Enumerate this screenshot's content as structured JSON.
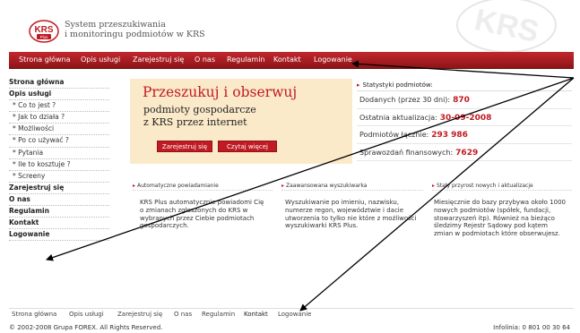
{
  "header": {
    "logo_text": "KRS",
    "logo_sub": "Plus",
    "tagline_line1": "System przeszukiwania",
    "tagline_line2": "i monitoringu podmiotów w KRS",
    "watermark": "KRS"
  },
  "nav": [
    "Strona główna",
    "Opis usługi",
    "Zarejestruj się",
    "O nas",
    "Regulamin",
    "Kontakt",
    "Logowanie"
  ],
  "sidebar": {
    "items": [
      {
        "label": "Strona główna",
        "level": "main"
      },
      {
        "label": "Opis usługi",
        "level": "main"
      },
      {
        "label": "* Co to jest ?",
        "level": "sub"
      },
      {
        "label": "* Jak to działa ?",
        "level": "sub"
      },
      {
        "label": "* Możliwości",
        "level": "sub"
      },
      {
        "label": "* Po co używać ?",
        "level": "sub"
      },
      {
        "label": "* Pytania",
        "level": "sub"
      },
      {
        "label": "* Ile to kosztuje ?",
        "level": "sub"
      },
      {
        "label": "* Screeny",
        "level": "sub"
      },
      {
        "label": "Zarejestruj się",
        "level": "main"
      },
      {
        "label": "O nas",
        "level": "main"
      },
      {
        "label": "Regulamin",
        "level": "main"
      },
      {
        "label": "Kontakt",
        "level": "main"
      },
      {
        "label": "Logowanie",
        "level": "main"
      }
    ]
  },
  "banner": {
    "title": "Przeszukuj i obserwuj",
    "line1": "podmioty gospodarcze",
    "line2": "z KRS przez internet",
    "register_button": "Zarejestruj się",
    "more_button": "Czytaj więcej"
  },
  "stats": {
    "heading": "Statystyki podmiotów:",
    "rows": [
      {
        "label": "Dodanych (przez 30 dni):",
        "value": "870"
      },
      {
        "label": "Ostatnia aktualizacja:",
        "value": "30-09-2008"
      },
      {
        "label": "Podmiotów łącznie:",
        "value": "293 986"
      },
      {
        "label": "Sprawozdań finansowych:",
        "value": "7629"
      }
    ]
  },
  "features": [
    {
      "heading": "Automatyczne powiadamianie",
      "text": "KRS Plus automatycznie powiadomi Cię o zmianach zgłoszonych do KRS w wybranych przez Ciebie podmiotach gospodarczych."
    },
    {
      "heading": "Zaawansowana wyszukiwarka",
      "text": "Wyszukiwanie po imieniu, nazwisku, numerze regon, województwie i dacie utworzenia to tylko nie które z możliwości wyszukiwarki KRS Plus."
    },
    {
      "heading": "Stały przyrost nowych i aktualizacje",
      "text": "Miesięcznie do bazy przybywa około 1000 nowych podmiotów (spółek, fundacji, stowarzyszeń itp). Również na bieżąco śledzimy Rejestr Sądowy pod kątem zmian w podmiotach które obserwujesz."
    }
  ],
  "footer": {
    "nav": [
      "Strona główna",
      "Opis usługi",
      "Zarejestruj się",
      "O nas",
      "Regulamin",
      "Kontakt",
      "Logowanie"
    ],
    "copyright": "© 2002-2008 Grupa FOREX. All Rights Reserved.",
    "infoline": "Infolinia: 0 801 00 30 64"
  },
  "colors": {
    "brand_red": "#c01a22",
    "banner_bg": "#fbeac9"
  }
}
